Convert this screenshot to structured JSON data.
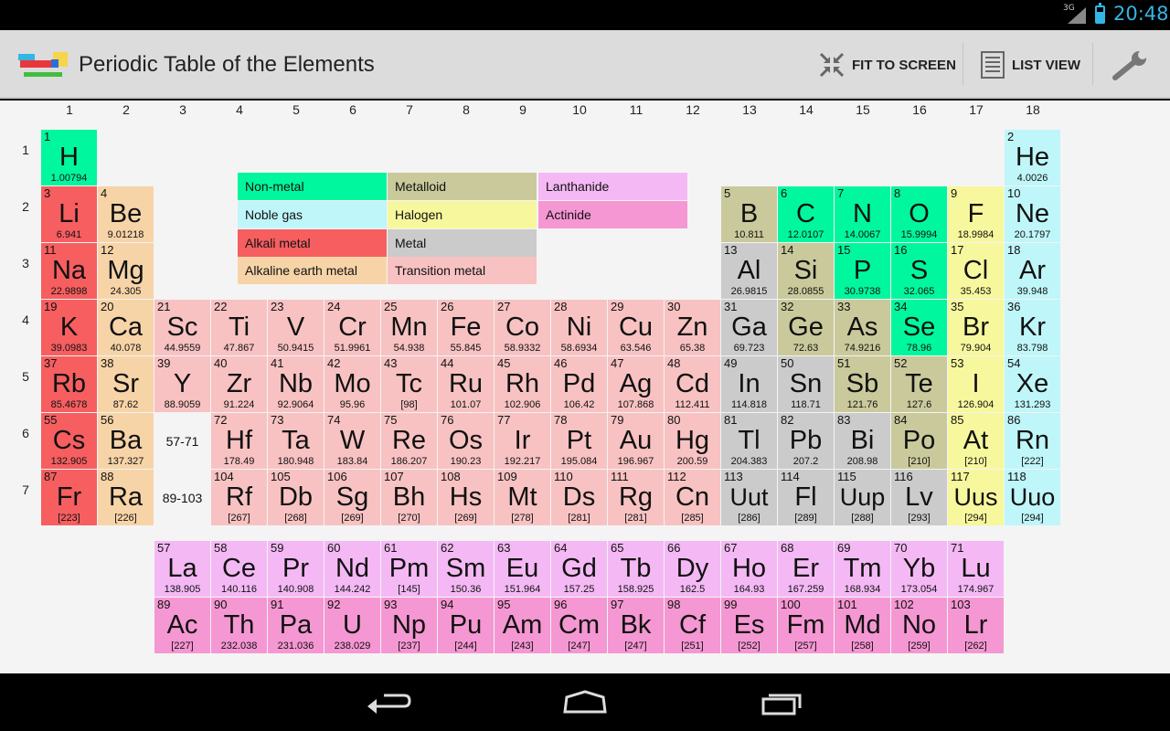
{
  "status": {
    "network": "3G",
    "time": "20:48"
  },
  "actionbar": {
    "title": "Periodic Table of the Elements",
    "fit_label": "FIT TO SCREEN",
    "list_label": "LIST VIEW",
    "icons": {
      "app": "app-logo-icon",
      "fit": "fit-to-screen-icon",
      "list": "list-view-icon",
      "settings": "wrench-icon"
    }
  },
  "columns": [
    "1",
    "2",
    "3",
    "4",
    "5",
    "6",
    "7",
    "8",
    "9",
    "10",
    "11",
    "12",
    "13",
    "14",
    "15",
    "16",
    "17",
    "18"
  ],
  "rows": [
    "1",
    "2",
    "3",
    "4",
    "5",
    "6",
    "7"
  ],
  "ranges": {
    "lanthanides": "57-71",
    "actinides": "89-103"
  },
  "colors": {
    "nonmetal": "#00f79d",
    "noble": "#bff6f9",
    "alkali": "#f65e60",
    "alkaline": "#f7d4a8",
    "metalloid": "#c9c99c",
    "halogen": "#f7f79d",
    "metal": "#cbcbcb",
    "transition": "#f8c2c2",
    "lanthanide": "#f4b9f4",
    "actinide": "#f597d3"
  },
  "legend": [
    {
      "cat": "nonmetal",
      "label": "Non-metal"
    },
    {
      "cat": "metalloid",
      "label": "Metalloid"
    },
    {
      "cat": "lanthanide",
      "label": "Lanthanide"
    },
    {
      "cat": "noble",
      "label": "Noble gas"
    },
    {
      "cat": "halogen",
      "label": "Halogen"
    },
    {
      "cat": "actinide",
      "label": "Actinide"
    },
    {
      "cat": "alkali",
      "label": "Alkali metal"
    },
    {
      "cat": "metal",
      "label": "Metal"
    },
    {
      "cat": "alkaline",
      "label": "Alkaline earth metal"
    },
    {
      "cat": "transition",
      "label": "Transition metal"
    }
  ],
  "elements": [
    {
      "n": "1",
      "s": "H",
      "m": "1.00794",
      "c": "nonmetal",
      "p": 1,
      "g": 1
    },
    {
      "n": "2",
      "s": "He",
      "m": "4.0026",
      "c": "noble",
      "p": 1,
      "g": 18
    },
    {
      "n": "3",
      "s": "Li",
      "m": "6.941",
      "c": "alkali",
      "p": 2,
      "g": 1
    },
    {
      "n": "4",
      "s": "Be",
      "m": "9.01218",
      "c": "alkaline",
      "p": 2,
      "g": 2
    },
    {
      "n": "5",
      "s": "B",
      "m": "10.811",
      "c": "metalloid",
      "p": 2,
      "g": 13
    },
    {
      "n": "6",
      "s": "C",
      "m": "12.0107",
      "c": "nonmetal",
      "p": 2,
      "g": 14
    },
    {
      "n": "7",
      "s": "N",
      "m": "14.0067",
      "c": "nonmetal",
      "p": 2,
      "g": 15
    },
    {
      "n": "8",
      "s": "O",
      "m": "15.9994",
      "c": "nonmetal",
      "p": 2,
      "g": 16
    },
    {
      "n": "9",
      "s": "F",
      "m": "18.9984",
      "c": "halogen",
      "p": 2,
      "g": 17
    },
    {
      "n": "10",
      "s": "Ne",
      "m": "20.1797",
      "c": "noble",
      "p": 2,
      "g": 18
    },
    {
      "n": "11",
      "s": "Na",
      "m": "22.9898",
      "c": "alkali",
      "p": 3,
      "g": 1
    },
    {
      "n": "12",
      "s": "Mg",
      "m": "24.305",
      "c": "alkaline",
      "p": 3,
      "g": 2
    },
    {
      "n": "13",
      "s": "Al",
      "m": "26.9815",
      "c": "metal",
      "p": 3,
      "g": 13
    },
    {
      "n": "14",
      "s": "Si",
      "m": "28.0855",
      "c": "metalloid",
      "p": 3,
      "g": 14
    },
    {
      "n": "15",
      "s": "P",
      "m": "30.9738",
      "c": "nonmetal",
      "p": 3,
      "g": 15
    },
    {
      "n": "16",
      "s": "S",
      "m": "32.065",
      "c": "nonmetal",
      "p": 3,
      "g": 16
    },
    {
      "n": "17",
      "s": "Cl",
      "m": "35.453",
      "c": "halogen",
      "p": 3,
      "g": 17
    },
    {
      "n": "18",
      "s": "Ar",
      "m": "39.948",
      "c": "noble",
      "p": 3,
      "g": 18
    },
    {
      "n": "19",
      "s": "K",
      "m": "39.0983",
      "c": "alkali",
      "p": 4,
      "g": 1
    },
    {
      "n": "20",
      "s": "Ca",
      "m": "40.078",
      "c": "alkaline",
      "p": 4,
      "g": 2
    },
    {
      "n": "21",
      "s": "Sc",
      "m": "44.9559",
      "c": "transition",
      "p": 4,
      "g": 3
    },
    {
      "n": "22",
      "s": "Ti",
      "m": "47.867",
      "c": "transition",
      "p": 4,
      "g": 4
    },
    {
      "n": "23",
      "s": "V",
      "m": "50.9415",
      "c": "transition",
      "p": 4,
      "g": 5
    },
    {
      "n": "24",
      "s": "Cr",
      "m": "51.9961",
      "c": "transition",
      "p": 4,
      "g": 6
    },
    {
      "n": "25",
      "s": "Mn",
      "m": "54.938",
      "c": "transition",
      "p": 4,
      "g": 7
    },
    {
      "n": "26",
      "s": "Fe",
      "m": "55.845",
      "c": "transition",
      "p": 4,
      "g": 8
    },
    {
      "n": "27",
      "s": "Co",
      "m": "58.9332",
      "c": "transition",
      "p": 4,
      "g": 9
    },
    {
      "n": "28",
      "s": "Ni",
      "m": "58.6934",
      "c": "transition",
      "p": 4,
      "g": 10
    },
    {
      "n": "29",
      "s": "Cu",
      "m": "63.546",
      "c": "transition",
      "p": 4,
      "g": 11
    },
    {
      "n": "30",
      "s": "Zn",
      "m": "65.38",
      "c": "transition",
      "p": 4,
      "g": 12
    },
    {
      "n": "31",
      "s": "Ga",
      "m": "69.723",
      "c": "metal",
      "p": 4,
      "g": 13
    },
    {
      "n": "32",
      "s": "Ge",
      "m": "72.63",
      "c": "metalloid",
      "p": 4,
      "g": 14
    },
    {
      "n": "33",
      "s": "As",
      "m": "74.9216",
      "c": "metalloid",
      "p": 4,
      "g": 15
    },
    {
      "n": "34",
      "s": "Se",
      "m": "78.96",
      "c": "nonmetal",
      "p": 4,
      "g": 16
    },
    {
      "n": "35",
      "s": "Br",
      "m": "79.904",
      "c": "halogen",
      "p": 4,
      "g": 17
    },
    {
      "n": "36",
      "s": "Kr",
      "m": "83.798",
      "c": "noble",
      "p": 4,
      "g": 18
    },
    {
      "n": "37",
      "s": "Rb",
      "m": "85.4678",
      "c": "alkali",
      "p": 5,
      "g": 1
    },
    {
      "n": "38",
      "s": "Sr",
      "m": "87.62",
      "c": "alkaline",
      "p": 5,
      "g": 2
    },
    {
      "n": "39",
      "s": "Y",
      "m": "88.9059",
      "c": "transition",
      "p": 5,
      "g": 3
    },
    {
      "n": "40",
      "s": "Zr",
      "m": "91.224",
      "c": "transition",
      "p": 5,
      "g": 4
    },
    {
      "n": "41",
      "s": "Nb",
      "m": "92.9064",
      "c": "transition",
      "p": 5,
      "g": 5
    },
    {
      "n": "42",
      "s": "Mo",
      "m": "95.96",
      "c": "transition",
      "p": 5,
      "g": 6
    },
    {
      "n": "43",
      "s": "Tc",
      "m": "[98]",
      "c": "transition",
      "p": 5,
      "g": 7
    },
    {
      "n": "44",
      "s": "Ru",
      "m": "101.07",
      "c": "transition",
      "p": 5,
      "g": 8
    },
    {
      "n": "45",
      "s": "Rh",
      "m": "102.906",
      "c": "transition",
      "p": 5,
      "g": 9
    },
    {
      "n": "46",
      "s": "Pd",
      "m": "106.42",
      "c": "transition",
      "p": 5,
      "g": 10
    },
    {
      "n": "47",
      "s": "Ag",
      "m": "107.868",
      "c": "transition",
      "p": 5,
      "g": 11
    },
    {
      "n": "48",
      "s": "Cd",
      "m": "112.411",
      "c": "transition",
      "p": 5,
      "g": 12
    },
    {
      "n": "49",
      "s": "In",
      "m": "114.818",
      "c": "metal",
      "p": 5,
      "g": 13
    },
    {
      "n": "50",
      "s": "Sn",
      "m": "118.71",
      "c": "metal",
      "p": 5,
      "g": 14
    },
    {
      "n": "51",
      "s": "Sb",
      "m": "121.76",
      "c": "metalloid",
      "p": 5,
      "g": 15
    },
    {
      "n": "52",
      "s": "Te",
      "m": "127.6",
      "c": "metalloid",
      "p": 5,
      "g": 16
    },
    {
      "n": "53",
      "s": "I",
      "m": "126.904",
      "c": "halogen",
      "p": 5,
      "g": 17
    },
    {
      "n": "54",
      "s": "Xe",
      "m": "131.293",
      "c": "noble",
      "p": 5,
      "g": 18
    },
    {
      "n": "55",
      "s": "Cs",
      "m": "132.905",
      "c": "alkali",
      "p": 6,
      "g": 1
    },
    {
      "n": "56",
      "s": "Ba",
      "m": "137.327",
      "c": "alkaline",
      "p": 6,
      "g": 2
    },
    {
      "n": "72",
      "s": "Hf",
      "m": "178.49",
      "c": "transition",
      "p": 6,
      "g": 4
    },
    {
      "n": "73",
      "s": "Ta",
      "m": "180.948",
      "c": "transition",
      "p": 6,
      "g": 5
    },
    {
      "n": "74",
      "s": "W",
      "m": "183.84",
      "c": "transition",
      "p": 6,
      "g": 6
    },
    {
      "n": "75",
      "s": "Re",
      "m": "186.207",
      "c": "transition",
      "p": 6,
      "g": 7
    },
    {
      "n": "76",
      "s": "Os",
      "m": "190.23",
      "c": "transition",
      "p": 6,
      "g": 8
    },
    {
      "n": "77",
      "s": "Ir",
      "m": "192.217",
      "c": "transition",
      "p": 6,
      "g": 9
    },
    {
      "n": "78",
      "s": "Pt",
      "m": "195.084",
      "c": "transition",
      "p": 6,
      "g": 10
    },
    {
      "n": "79",
      "s": "Au",
      "m": "196.967",
      "c": "transition",
      "p": 6,
      "g": 11
    },
    {
      "n": "80",
      "s": "Hg",
      "m": "200.59",
      "c": "transition",
      "p": 6,
      "g": 12
    },
    {
      "n": "81",
      "s": "Tl",
      "m": "204.383",
      "c": "metal",
      "p": 6,
      "g": 13
    },
    {
      "n": "82",
      "s": "Pb",
      "m": "207.2",
      "c": "metal",
      "p": 6,
      "g": 14
    },
    {
      "n": "83",
      "s": "Bi",
      "m": "208.98",
      "c": "metal",
      "p": 6,
      "g": 15
    },
    {
      "n": "84",
      "s": "Po",
      "m": "[210]",
      "c": "metalloid",
      "p": 6,
      "g": 16
    },
    {
      "n": "85",
      "s": "At",
      "m": "[210]",
      "c": "halogen",
      "p": 6,
      "g": 17
    },
    {
      "n": "86",
      "s": "Rn",
      "m": "[222]",
      "c": "noble",
      "p": 6,
      "g": 18
    },
    {
      "n": "87",
      "s": "Fr",
      "m": "[223]",
      "c": "alkali",
      "p": 7,
      "g": 1
    },
    {
      "n": "88",
      "s": "Ra",
      "m": "[226]",
      "c": "alkaline",
      "p": 7,
      "g": 2
    },
    {
      "n": "104",
      "s": "Rf",
      "m": "[267]",
      "c": "transition",
      "p": 7,
      "g": 4
    },
    {
      "n": "105",
      "s": "Db",
      "m": "[268]",
      "c": "transition",
      "p": 7,
      "g": 5
    },
    {
      "n": "106",
      "s": "Sg",
      "m": "[269]",
      "c": "transition",
      "p": 7,
      "g": 6
    },
    {
      "n": "107",
      "s": "Bh",
      "m": "[270]",
      "c": "transition",
      "p": 7,
      "g": 7
    },
    {
      "n": "108",
      "s": "Hs",
      "m": "[269]",
      "c": "transition",
      "p": 7,
      "g": 8
    },
    {
      "n": "109",
      "s": "Mt",
      "m": "[278]",
      "c": "transition",
      "p": 7,
      "g": 9
    },
    {
      "n": "110",
      "s": "Ds",
      "m": "[281]",
      "c": "transition",
      "p": 7,
      "g": 10
    },
    {
      "n": "111",
      "s": "Rg",
      "m": "[281]",
      "c": "transition",
      "p": 7,
      "g": 11
    },
    {
      "n": "112",
      "s": "Cn",
      "m": "[285]",
      "c": "transition",
      "p": 7,
      "g": 12
    },
    {
      "n": "113",
      "s": "Uut",
      "m": "[286]",
      "c": "metal",
      "p": 7,
      "g": 13
    },
    {
      "n": "114",
      "s": "Fl",
      "m": "[289]",
      "c": "metal",
      "p": 7,
      "g": 14
    },
    {
      "n": "115",
      "s": "Uup",
      "m": "[288]",
      "c": "metal",
      "p": 7,
      "g": 15
    },
    {
      "n": "116",
      "s": "Lv",
      "m": "[293]",
      "c": "metal",
      "p": 7,
      "g": 16
    },
    {
      "n": "117",
      "s": "Uus",
      "m": "[294]",
      "c": "halogen",
      "p": 7,
      "g": 17
    },
    {
      "n": "118",
      "s": "Uuo",
      "m": "[294]",
      "c": "noble",
      "p": 7,
      "g": 18
    },
    {
      "n": "57",
      "s": "La",
      "m": "138.905",
      "c": "lanthanide",
      "p": 8,
      "g": 3
    },
    {
      "n": "58",
      "s": "Ce",
      "m": "140.116",
      "c": "lanthanide",
      "p": 8,
      "g": 4
    },
    {
      "n": "59",
      "s": "Pr",
      "m": "140.908",
      "c": "lanthanide",
      "p": 8,
      "g": 5
    },
    {
      "n": "60",
      "s": "Nd",
      "m": "144.242",
      "c": "lanthanide",
      "p": 8,
      "g": 6
    },
    {
      "n": "61",
      "s": "Pm",
      "m": "[145]",
      "c": "lanthanide",
      "p": 8,
      "g": 7
    },
    {
      "n": "62",
      "s": "Sm",
      "m": "150.36",
      "c": "lanthanide",
      "p": 8,
      "g": 8
    },
    {
      "n": "63",
      "s": "Eu",
      "m": "151.964",
      "c": "lanthanide",
      "p": 8,
      "g": 9
    },
    {
      "n": "64",
      "s": "Gd",
      "m": "157.25",
      "c": "lanthanide",
      "p": 8,
      "g": 10
    },
    {
      "n": "65",
      "s": "Tb",
      "m": "158.925",
      "c": "lanthanide",
      "p": 8,
      "g": 11
    },
    {
      "n": "66",
      "s": "Dy",
      "m": "162.5",
      "c": "lanthanide",
      "p": 8,
      "g": 12
    },
    {
      "n": "67",
      "s": "Ho",
      "m": "164.93",
      "c": "lanthanide",
      "p": 8,
      "g": 13
    },
    {
      "n": "68",
      "s": "Er",
      "m": "167.259",
      "c": "lanthanide",
      "p": 8,
      "g": 14
    },
    {
      "n": "69",
      "s": "Tm",
      "m": "168.934",
      "c": "lanthanide",
      "p": 8,
      "g": 15
    },
    {
      "n": "70",
      "s": "Yb",
      "m": "173.054",
      "c": "lanthanide",
      "p": 8,
      "g": 16
    },
    {
      "n": "71",
      "s": "Lu",
      "m": "174.967",
      "c": "lanthanide",
      "p": 8,
      "g": 17
    },
    {
      "n": "89",
      "s": "Ac",
      "m": "[227]",
      "c": "actinide",
      "p": 9,
      "g": 3
    },
    {
      "n": "90",
      "s": "Th",
      "m": "232.038",
      "c": "actinide",
      "p": 9,
      "g": 4
    },
    {
      "n": "91",
      "s": "Pa",
      "m": "231.036",
      "c": "actinide",
      "p": 9,
      "g": 5
    },
    {
      "n": "92",
      "s": "U",
      "m": "238.029",
      "c": "actinide",
      "p": 9,
      "g": 6
    },
    {
      "n": "93",
      "s": "Np",
      "m": "[237]",
      "c": "actinide",
      "p": 9,
      "g": 7
    },
    {
      "n": "94",
      "s": "Pu",
      "m": "[244]",
      "c": "actinide",
      "p": 9,
      "g": 8
    },
    {
      "n": "95",
      "s": "Am",
      "m": "[243]",
      "c": "actinide",
      "p": 9,
      "g": 9
    },
    {
      "n": "96",
      "s": "Cm",
      "m": "[247]",
      "c": "actinide",
      "p": 9,
      "g": 10
    },
    {
      "n": "97",
      "s": "Bk",
      "m": "[247]",
      "c": "actinide",
      "p": 9,
      "g": 11
    },
    {
      "n": "98",
      "s": "Cf",
      "m": "[251]",
      "c": "actinide",
      "p": 9,
      "g": 12
    },
    {
      "n": "99",
      "s": "Es",
      "m": "[252]",
      "c": "actinide",
      "p": 9,
      "g": 13
    },
    {
      "n": "100",
      "s": "Fm",
      "m": "[257]",
      "c": "actinide",
      "p": 9,
      "g": 14
    },
    {
      "n": "101",
      "s": "Md",
      "m": "[258]",
      "c": "actinide",
      "p": 9,
      "g": 15
    },
    {
      "n": "102",
      "s": "No",
      "m": "[259]",
      "c": "actinide",
      "p": 9,
      "g": 16
    },
    {
      "n": "103",
      "s": "Lr",
      "m": "[262]",
      "c": "actinide",
      "p": 9,
      "g": 17
    }
  ],
  "navbar": {
    "back": "back-icon",
    "home": "home-icon",
    "recent": "recent-apps-icon"
  }
}
